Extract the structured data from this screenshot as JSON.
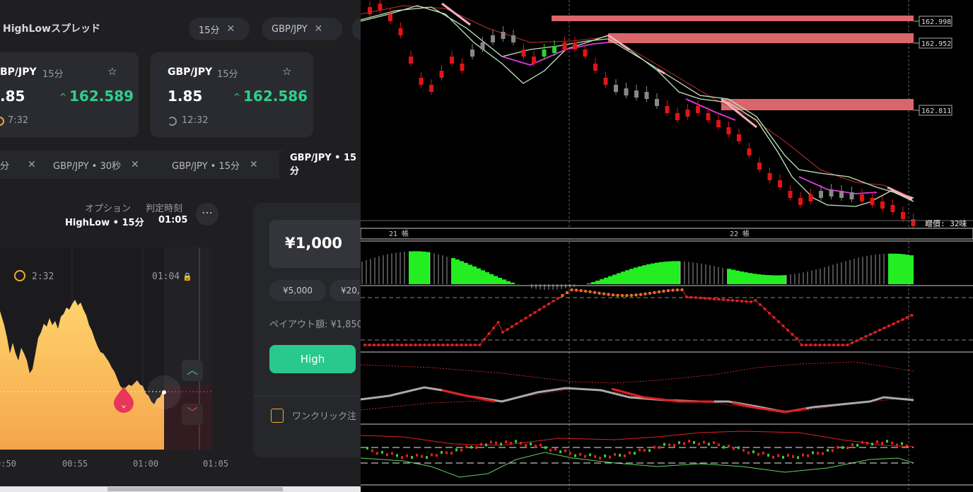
{
  "header": {
    "title": "HighLowスプレッド",
    "pills": [
      "15分",
      "GBP/JPY"
    ]
  },
  "cards": [
    {
      "pair": "BP/JPY",
      "period": "15分",
      "payout": ".85",
      "price": "162.589",
      "timer": "7:32"
    },
    {
      "pair": "GBP/JPY",
      "period": "15分",
      "payout": "1.85",
      "price": "162.586",
      "timer": "12:32"
    }
  ],
  "tabs": [
    {
      "label": "分"
    },
    {
      "label": "GBP/JPY • 30秒"
    },
    {
      "label": "GBP/JPY • 15分"
    },
    {
      "label": "GBP/JPY • 15分"
    }
  ],
  "option": {
    "label": "オプション",
    "value": "HighLow • 15分",
    "expiry_label": "判定時刻",
    "expiry_value": "01:05"
  },
  "chart": {
    "countdown": "2:32",
    "close_time": "01:04",
    "xticks": [
      "0:50",
      "00:55",
      "01:00",
      "01:05"
    ],
    "area_fill": "#f5b95a"
  },
  "trade": {
    "amount": "¥1,000",
    "presets": [
      "¥5,000",
      "¥20,"
    ],
    "payout": "ペイアウト額: ¥1,850",
    "high_label": "High",
    "high_color": "#28c98b",
    "oneclick": "ワンクリック注"
  },
  "mt": {
    "levels": [
      "162.998",
      "162.952",
      "162.811"
    ],
    "day_labels": [
      "21 帳",
      "22 帳"
    ],
    "status": "嶒價: 32味"
  }
}
